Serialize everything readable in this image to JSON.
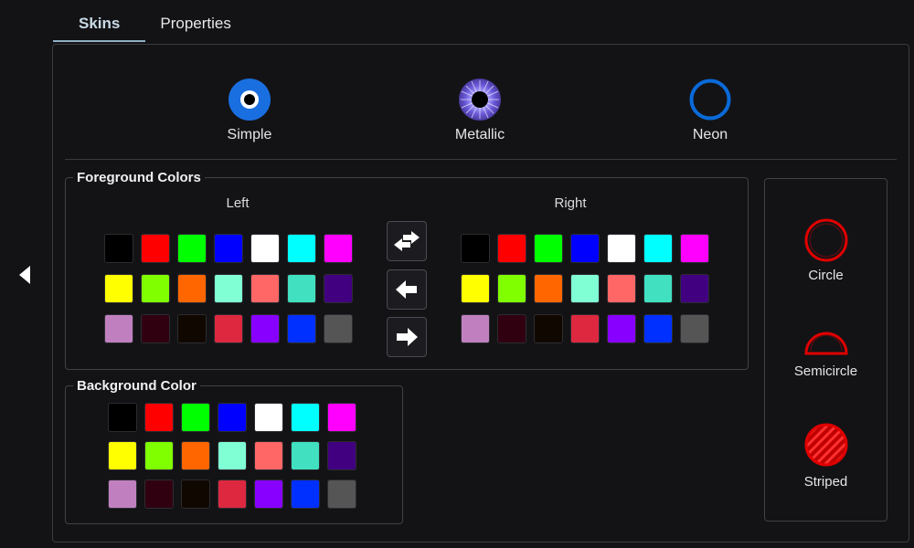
{
  "tabs": [
    {
      "label": "Skins",
      "active": true
    },
    {
      "label": "Properties",
      "active": false
    }
  ],
  "skins": [
    {
      "label": "Simple",
      "icon": "simple-eye-icon"
    },
    {
      "label": "Metallic",
      "icon": "metallic-eye-icon"
    },
    {
      "label": "Neon",
      "icon": "neon-ring-icon"
    }
  ],
  "foreground": {
    "title": "Foreground Colors",
    "left_label": "Left",
    "right_label": "Right"
  },
  "background": {
    "title": "Background Color"
  },
  "palette": [
    "#000000",
    "#ff0000",
    "#00ff00",
    "#0000ff",
    "#ffffff",
    "#00ffff",
    "#ff00ff",
    "#ffff00",
    "#80ff00",
    "#ff6600",
    "#80ffd4",
    "#ff6666",
    "#40e0c0",
    "#400080",
    "#c080c0",
    "#300010",
    "#100800",
    "#dd2840",
    "#8800ff",
    "#0030ff",
    "#555555"
  ],
  "arrow_buttons": [
    {
      "icon": "swap-arrows-icon"
    },
    {
      "icon": "arrow-left-icon"
    },
    {
      "icon": "arrow-right-icon"
    }
  ],
  "shapes": [
    {
      "label": "Circle",
      "icon": "circle-shape-icon"
    },
    {
      "label": "Semicircle",
      "icon": "semicircle-shape-icon"
    },
    {
      "label": "Striped",
      "icon": "striped-shape-icon"
    }
  ],
  "colors": {
    "accent_blue": "#1a6fe0",
    "neon_blue": "#0a6ad8",
    "shape_red": "#e00000"
  }
}
